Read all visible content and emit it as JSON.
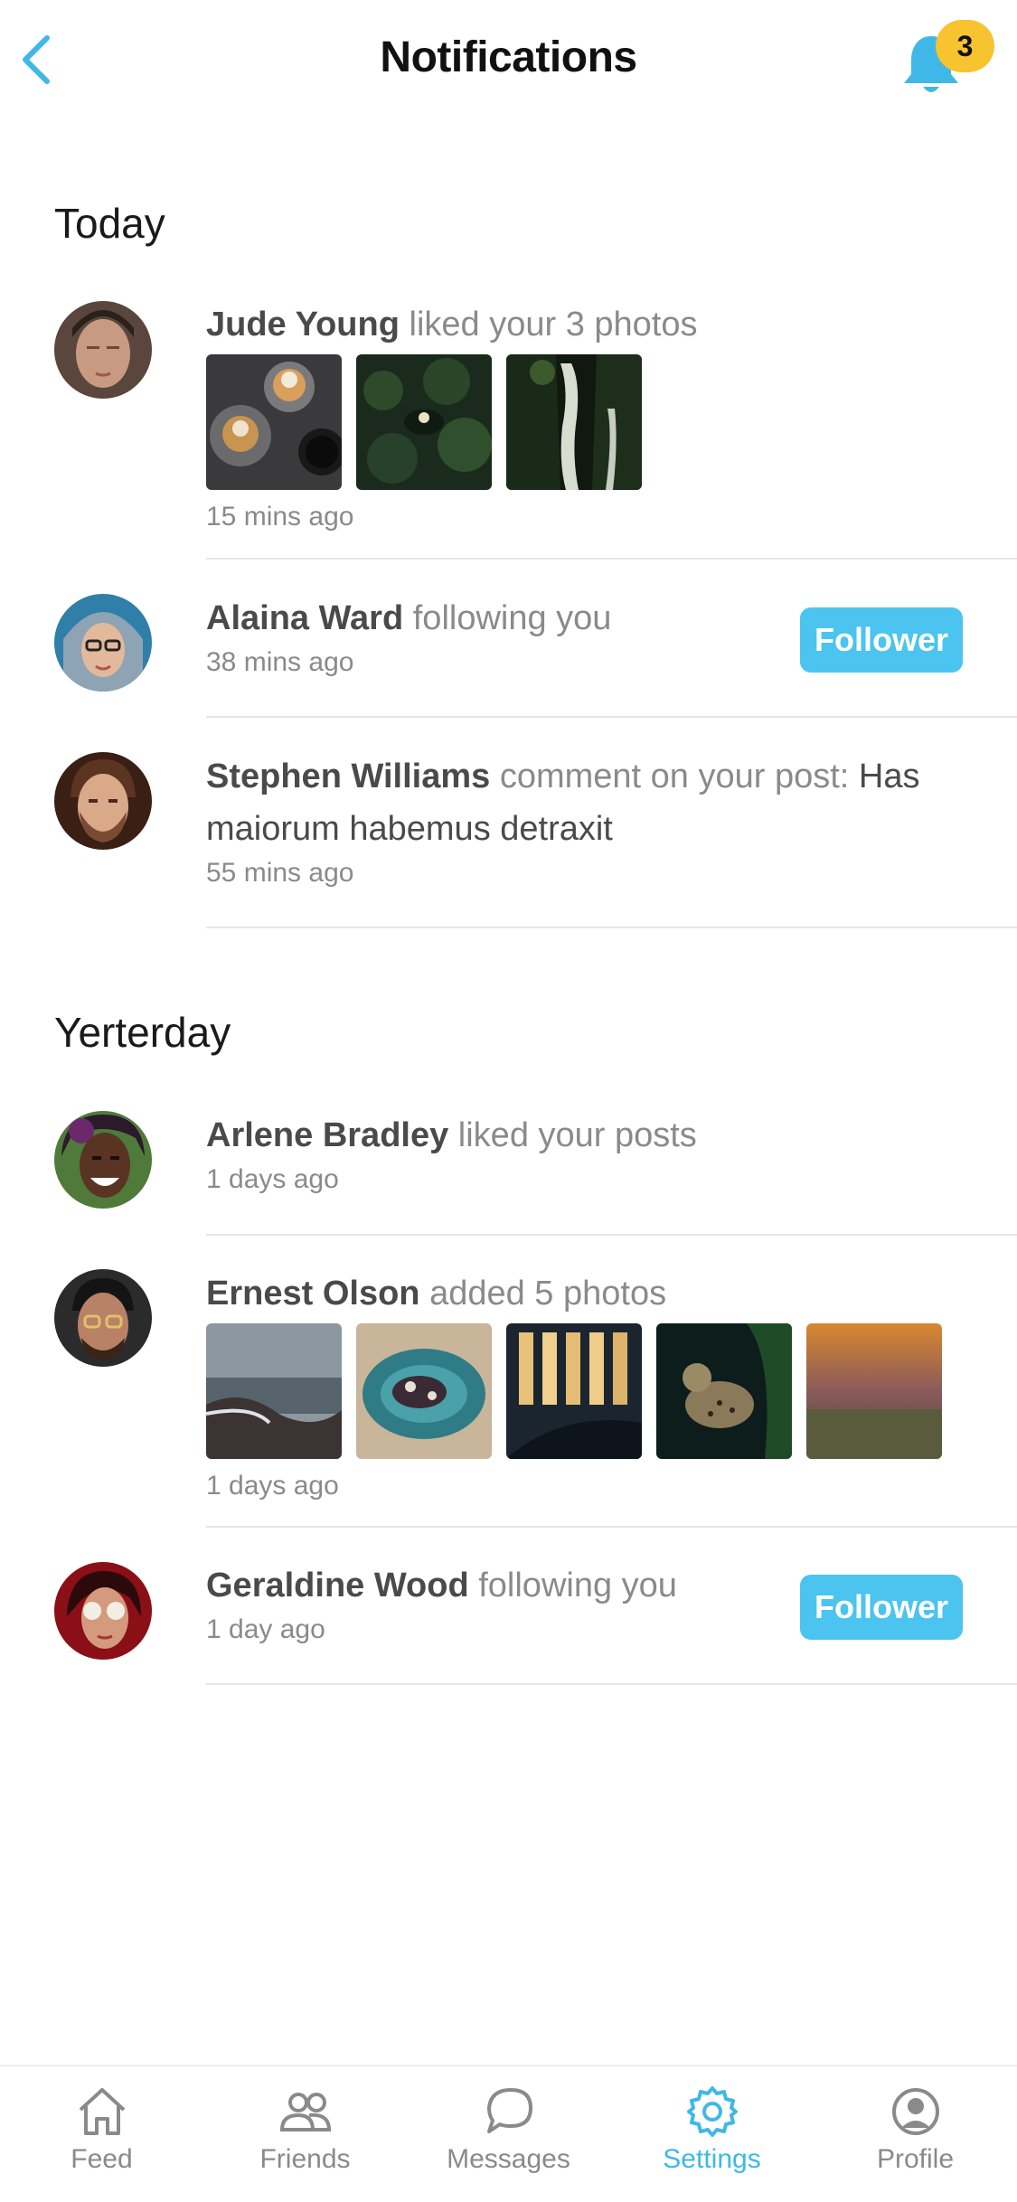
{
  "header": {
    "title": "Notifications",
    "badge_count": "3"
  },
  "sections": {
    "today": "Today",
    "yesterday": "Yerterday"
  },
  "notifications": [
    {
      "name": "Jude Young",
      "action": "liked your 3 photos",
      "content": "",
      "time": "15 mins ago",
      "photos": 3
    },
    {
      "name": "Alaina Ward",
      "action": "following you",
      "content": "",
      "time": "38 mins ago",
      "button": "Follower"
    },
    {
      "name": "Stephen Williams",
      "action": "comment on your post:",
      "content": "Has maiorum habemus detraxit",
      "time": "55 mins ago"
    },
    {
      "name": "Arlene Bradley",
      "action": "liked your posts",
      "content": "",
      "time": "1 days ago"
    },
    {
      "name": "Ernest Olson",
      "action": "added 5 photos",
      "content": "",
      "time": "1 days ago",
      "photos": 5
    },
    {
      "name": "Geraldine Wood",
      "action": "following you",
      "content": "",
      "time": "1 day ago",
      "button": "Follower"
    }
  ],
  "tabbar": {
    "items": [
      {
        "label": "Feed",
        "icon": "home-icon"
      },
      {
        "label": "Friends",
        "icon": "people-icon"
      },
      {
        "label": "Messages",
        "icon": "chat-bubble-icon"
      },
      {
        "label": "Settings",
        "icon": "gear-icon",
        "active": true
      },
      {
        "label": "Profile",
        "icon": "user-circle-icon"
      }
    ]
  },
  "colors": {
    "accent": "#3fb8e8",
    "badge": "#f7c32e",
    "button": "#4bc4ef"
  }
}
